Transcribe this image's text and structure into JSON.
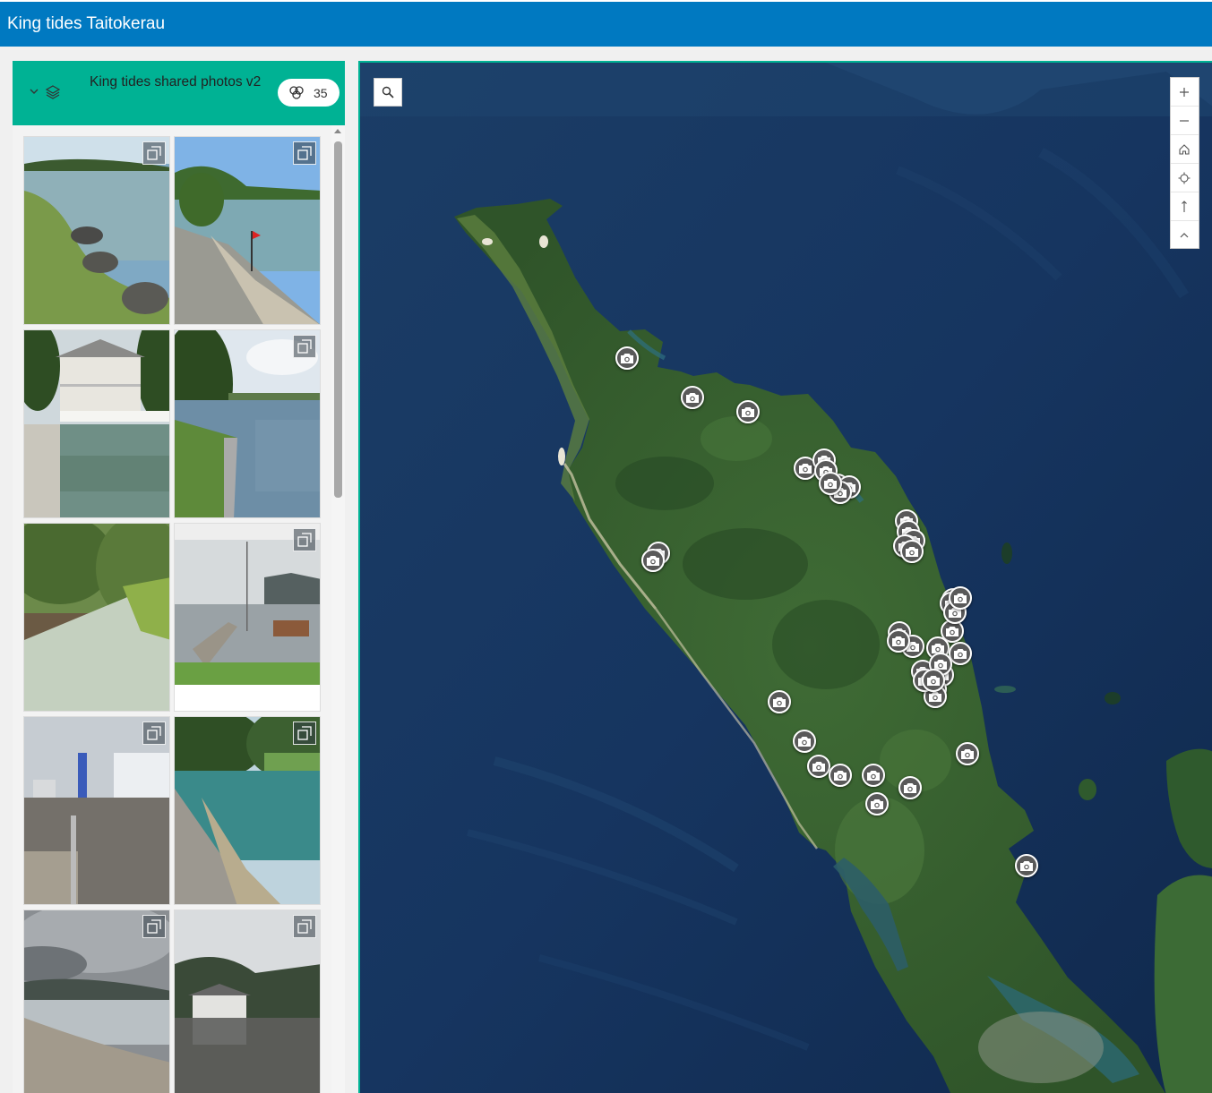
{
  "app": {
    "title": "King tides Taitokerau"
  },
  "layer": {
    "title": "King tides shared photos v2",
    "count": "35"
  },
  "gallery": {
    "photos": [
      {
        "scene": "river-bank-rocks"
      },
      {
        "scene": "seawall-path-flag"
      },
      {
        "scene": "villa-wharf"
      },
      {
        "scene": "flooded-lawn-lake"
      },
      {
        "scene": "mangrove-creek"
      },
      {
        "scene": "marina-jetty"
      },
      {
        "scene": "flooded-street"
      },
      {
        "scene": "rock-wall-water"
      },
      {
        "scene": "beach-clouds"
      },
      {
        "scene": "boathouse-harbour"
      }
    ]
  },
  "map": {
    "markers": 44,
    "icons": {
      "search": "search-icon",
      "zoom_in": "zoom-in-icon",
      "zoom_out": "zoom-out-icon",
      "home": "home-icon",
      "locate": "locate-icon",
      "compass": "compass-icon",
      "collapse": "chevron-up-icon"
    }
  },
  "colors": {
    "header": "#0079c1",
    "accent": "#00b294",
    "marker": "#595959",
    "ocean": "#14325c",
    "land": "#3f6b35"
  }
}
